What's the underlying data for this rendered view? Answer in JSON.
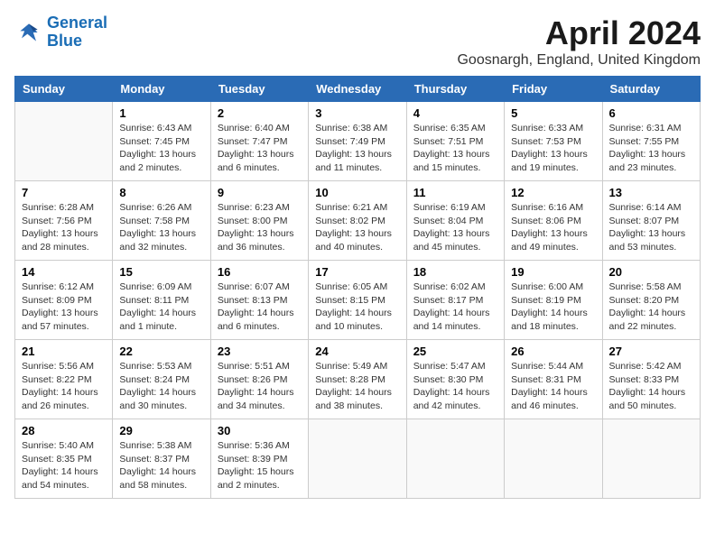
{
  "header": {
    "logo_line1": "General",
    "logo_line2": "Blue",
    "month": "April 2024",
    "location": "Goosnargh, England, United Kingdom"
  },
  "weekdays": [
    "Sunday",
    "Monday",
    "Tuesday",
    "Wednesday",
    "Thursday",
    "Friday",
    "Saturday"
  ],
  "weeks": [
    [
      {
        "day": "",
        "info": ""
      },
      {
        "day": "1",
        "info": "Sunrise: 6:43 AM\nSunset: 7:45 PM\nDaylight: 13 hours\nand 2 minutes."
      },
      {
        "day": "2",
        "info": "Sunrise: 6:40 AM\nSunset: 7:47 PM\nDaylight: 13 hours\nand 6 minutes."
      },
      {
        "day": "3",
        "info": "Sunrise: 6:38 AM\nSunset: 7:49 PM\nDaylight: 13 hours\nand 11 minutes."
      },
      {
        "day": "4",
        "info": "Sunrise: 6:35 AM\nSunset: 7:51 PM\nDaylight: 13 hours\nand 15 minutes."
      },
      {
        "day": "5",
        "info": "Sunrise: 6:33 AM\nSunset: 7:53 PM\nDaylight: 13 hours\nand 19 minutes."
      },
      {
        "day": "6",
        "info": "Sunrise: 6:31 AM\nSunset: 7:55 PM\nDaylight: 13 hours\nand 23 minutes."
      }
    ],
    [
      {
        "day": "7",
        "info": "Sunrise: 6:28 AM\nSunset: 7:56 PM\nDaylight: 13 hours\nand 28 minutes."
      },
      {
        "day": "8",
        "info": "Sunrise: 6:26 AM\nSunset: 7:58 PM\nDaylight: 13 hours\nand 32 minutes."
      },
      {
        "day": "9",
        "info": "Sunrise: 6:23 AM\nSunset: 8:00 PM\nDaylight: 13 hours\nand 36 minutes."
      },
      {
        "day": "10",
        "info": "Sunrise: 6:21 AM\nSunset: 8:02 PM\nDaylight: 13 hours\nand 40 minutes."
      },
      {
        "day": "11",
        "info": "Sunrise: 6:19 AM\nSunset: 8:04 PM\nDaylight: 13 hours\nand 45 minutes."
      },
      {
        "day": "12",
        "info": "Sunrise: 6:16 AM\nSunset: 8:06 PM\nDaylight: 13 hours\nand 49 minutes."
      },
      {
        "day": "13",
        "info": "Sunrise: 6:14 AM\nSunset: 8:07 PM\nDaylight: 13 hours\nand 53 minutes."
      }
    ],
    [
      {
        "day": "14",
        "info": "Sunrise: 6:12 AM\nSunset: 8:09 PM\nDaylight: 13 hours\nand 57 minutes."
      },
      {
        "day": "15",
        "info": "Sunrise: 6:09 AM\nSunset: 8:11 PM\nDaylight: 14 hours\nand 1 minute."
      },
      {
        "day": "16",
        "info": "Sunrise: 6:07 AM\nSunset: 8:13 PM\nDaylight: 14 hours\nand 6 minutes."
      },
      {
        "day": "17",
        "info": "Sunrise: 6:05 AM\nSunset: 8:15 PM\nDaylight: 14 hours\nand 10 minutes."
      },
      {
        "day": "18",
        "info": "Sunrise: 6:02 AM\nSunset: 8:17 PM\nDaylight: 14 hours\nand 14 minutes."
      },
      {
        "day": "19",
        "info": "Sunrise: 6:00 AM\nSunset: 8:19 PM\nDaylight: 14 hours\nand 18 minutes."
      },
      {
        "day": "20",
        "info": "Sunrise: 5:58 AM\nSunset: 8:20 PM\nDaylight: 14 hours\nand 22 minutes."
      }
    ],
    [
      {
        "day": "21",
        "info": "Sunrise: 5:56 AM\nSunset: 8:22 PM\nDaylight: 14 hours\nand 26 minutes."
      },
      {
        "day": "22",
        "info": "Sunrise: 5:53 AM\nSunset: 8:24 PM\nDaylight: 14 hours\nand 30 minutes."
      },
      {
        "day": "23",
        "info": "Sunrise: 5:51 AM\nSunset: 8:26 PM\nDaylight: 14 hours\nand 34 minutes."
      },
      {
        "day": "24",
        "info": "Sunrise: 5:49 AM\nSunset: 8:28 PM\nDaylight: 14 hours\nand 38 minutes."
      },
      {
        "day": "25",
        "info": "Sunrise: 5:47 AM\nSunset: 8:30 PM\nDaylight: 14 hours\nand 42 minutes."
      },
      {
        "day": "26",
        "info": "Sunrise: 5:44 AM\nSunset: 8:31 PM\nDaylight: 14 hours\nand 46 minutes."
      },
      {
        "day": "27",
        "info": "Sunrise: 5:42 AM\nSunset: 8:33 PM\nDaylight: 14 hours\nand 50 minutes."
      }
    ],
    [
      {
        "day": "28",
        "info": "Sunrise: 5:40 AM\nSunset: 8:35 PM\nDaylight: 14 hours\nand 54 minutes."
      },
      {
        "day": "29",
        "info": "Sunrise: 5:38 AM\nSunset: 8:37 PM\nDaylight: 14 hours\nand 58 minutes."
      },
      {
        "day": "30",
        "info": "Sunrise: 5:36 AM\nSunset: 8:39 PM\nDaylight: 15 hours\nand 2 minutes."
      },
      {
        "day": "",
        "info": ""
      },
      {
        "day": "",
        "info": ""
      },
      {
        "day": "",
        "info": ""
      },
      {
        "day": "",
        "info": ""
      }
    ]
  ]
}
